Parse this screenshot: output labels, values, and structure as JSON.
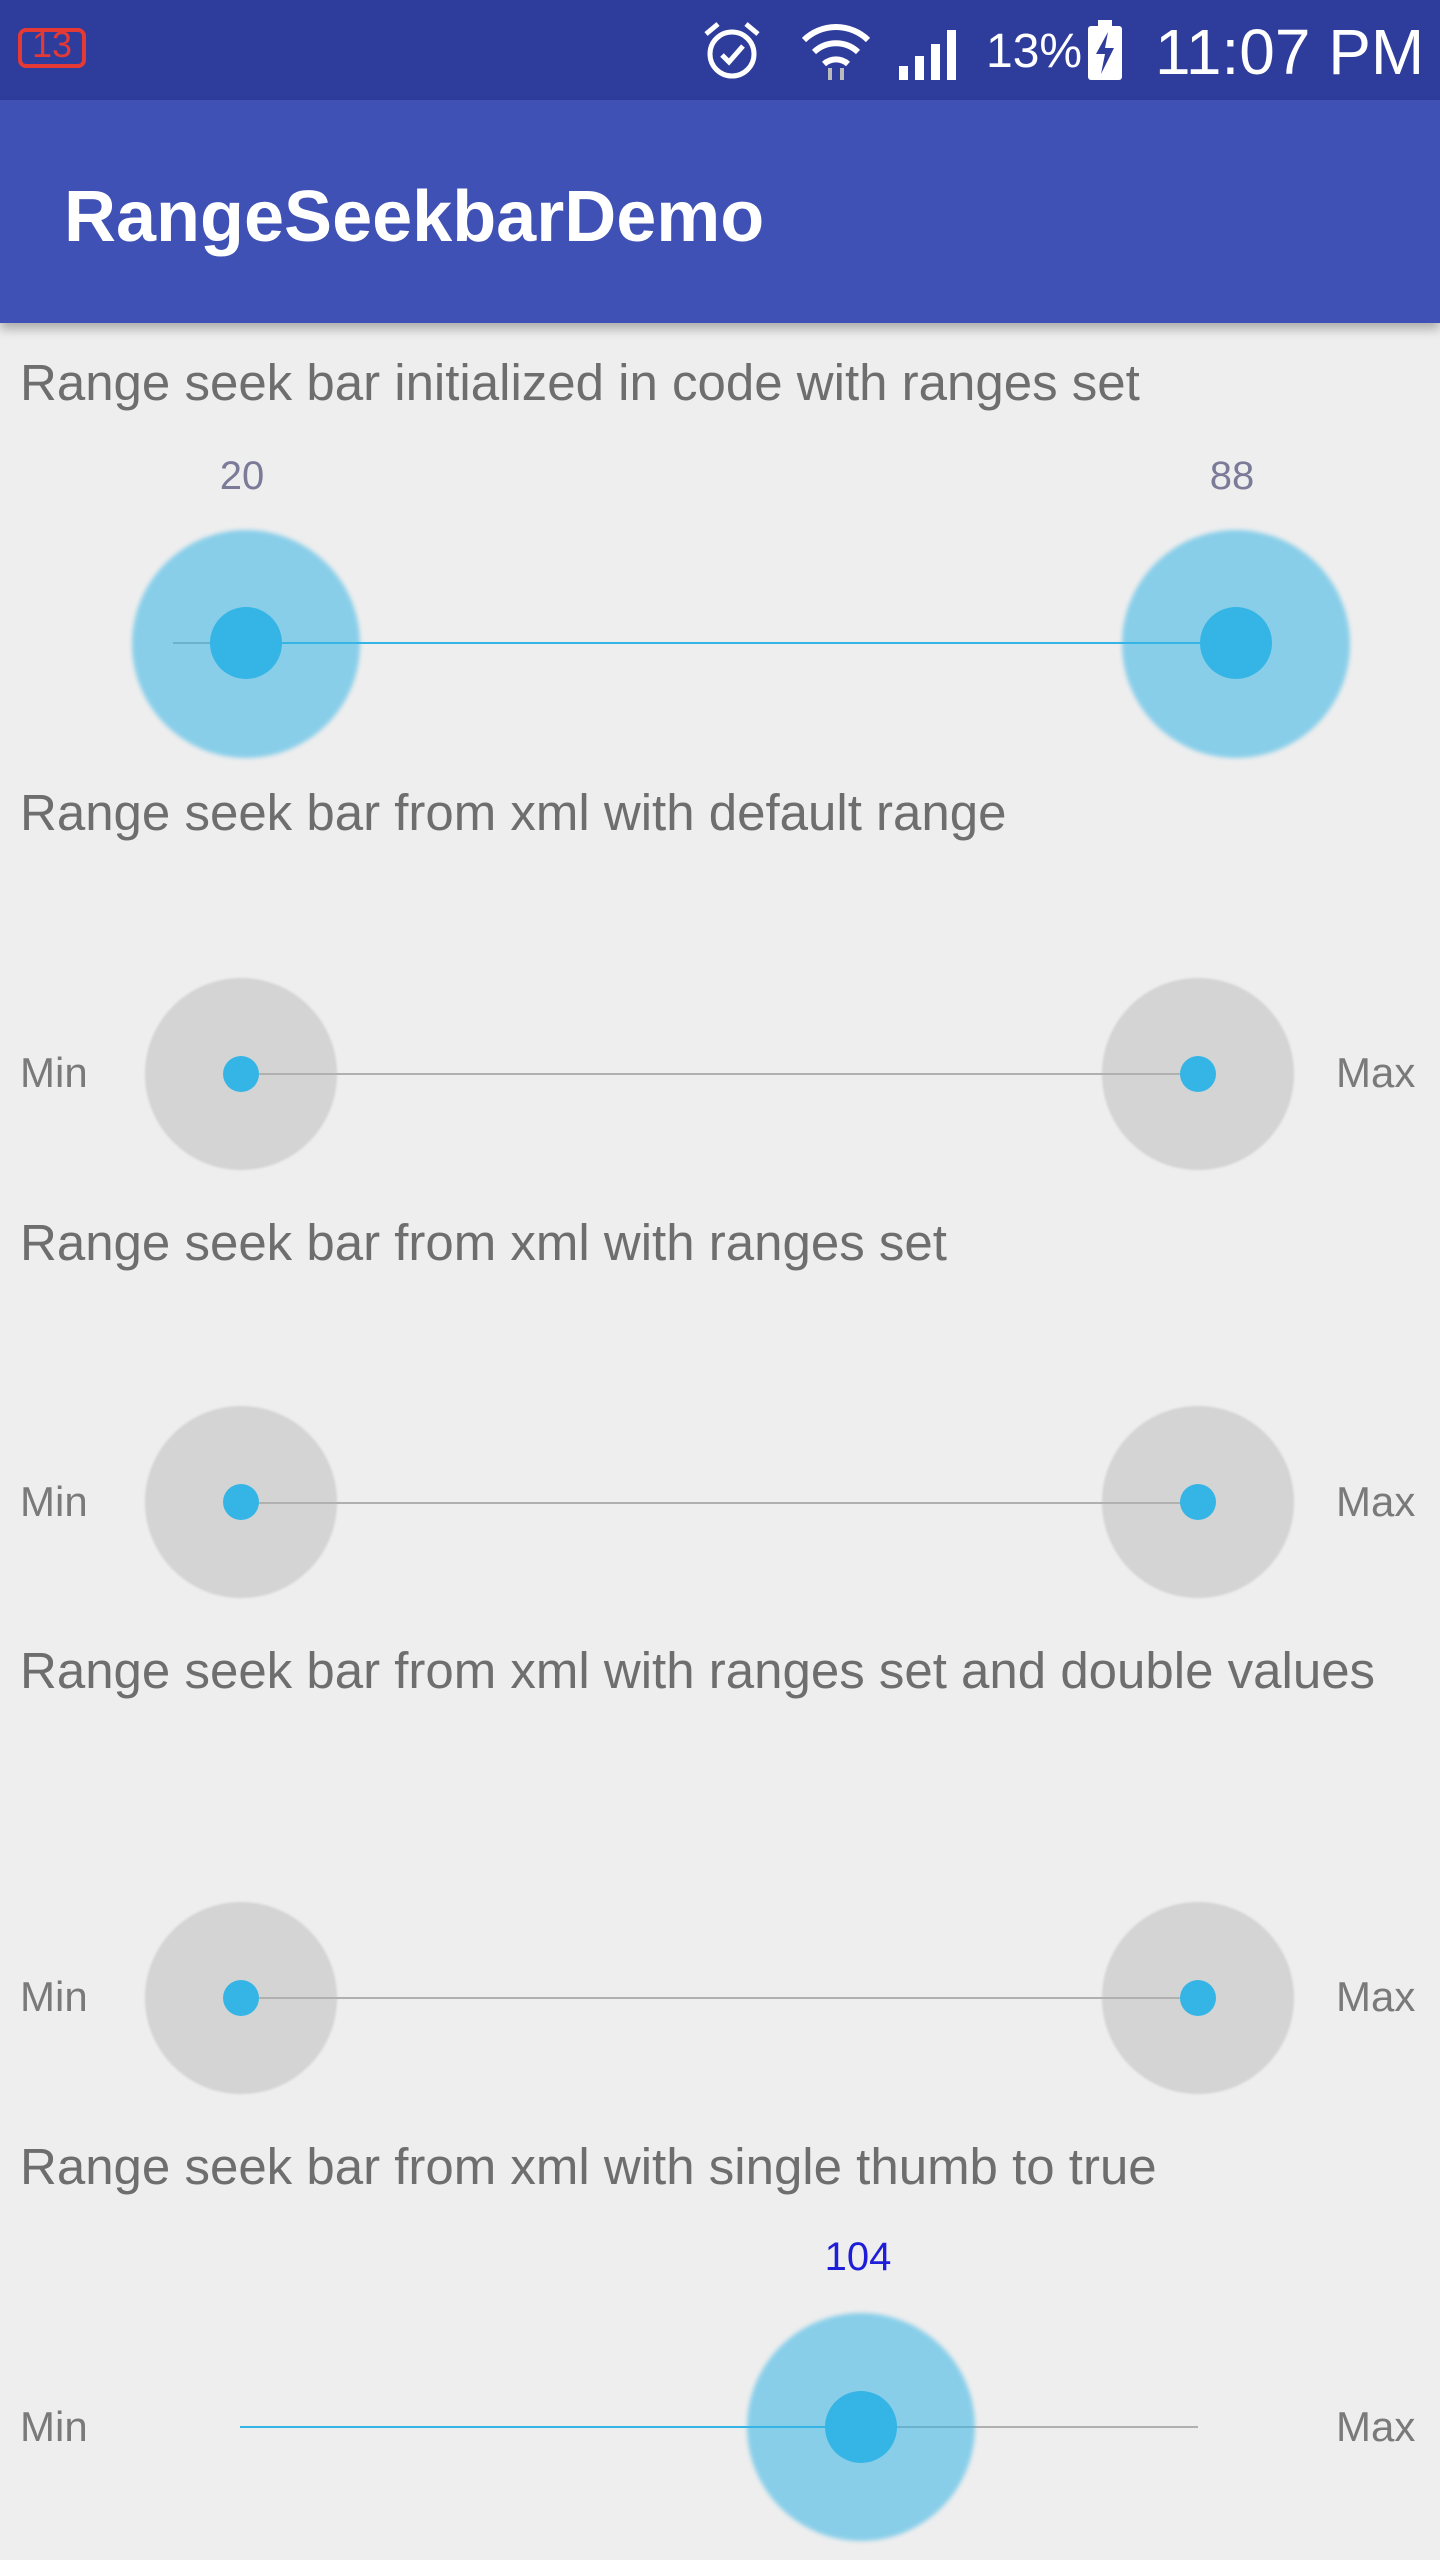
{
  "status_bar": {
    "notification_count": "13",
    "battery_percent": "13%",
    "time": "11:07 PM",
    "icons": [
      "notification-count-icon",
      "alarm-icon",
      "wifi-icon",
      "signal-icon",
      "battery-charging-icon"
    ]
  },
  "app_bar": {
    "title": "RangeSeekbarDemo"
  },
  "sections": [
    {
      "label": "Range seek bar initialized in code with ranges set",
      "min_value_label": "20",
      "max_value_label": "88"
    },
    {
      "label": "Range seek bar from xml with default range",
      "min_label": "Min",
      "max_label": "Max"
    },
    {
      "label": "Range seek bar from xml with ranges set",
      "min_label": "Min",
      "max_label": "Max"
    },
    {
      "label": "Range seek bar from xml with ranges set and double values",
      "min_label": "Min",
      "max_label": "Max"
    },
    {
      "label": "Range seek bar from xml with single thumb to true",
      "value_label": "104",
      "min_label": "Min",
      "max_label": "Max"
    }
  ],
  "colors": {
    "status_bar": "#2E3C9C",
    "app_bar": "#3F51B5",
    "accent": "#34B5E5",
    "background": "#EEEEEE"
  }
}
